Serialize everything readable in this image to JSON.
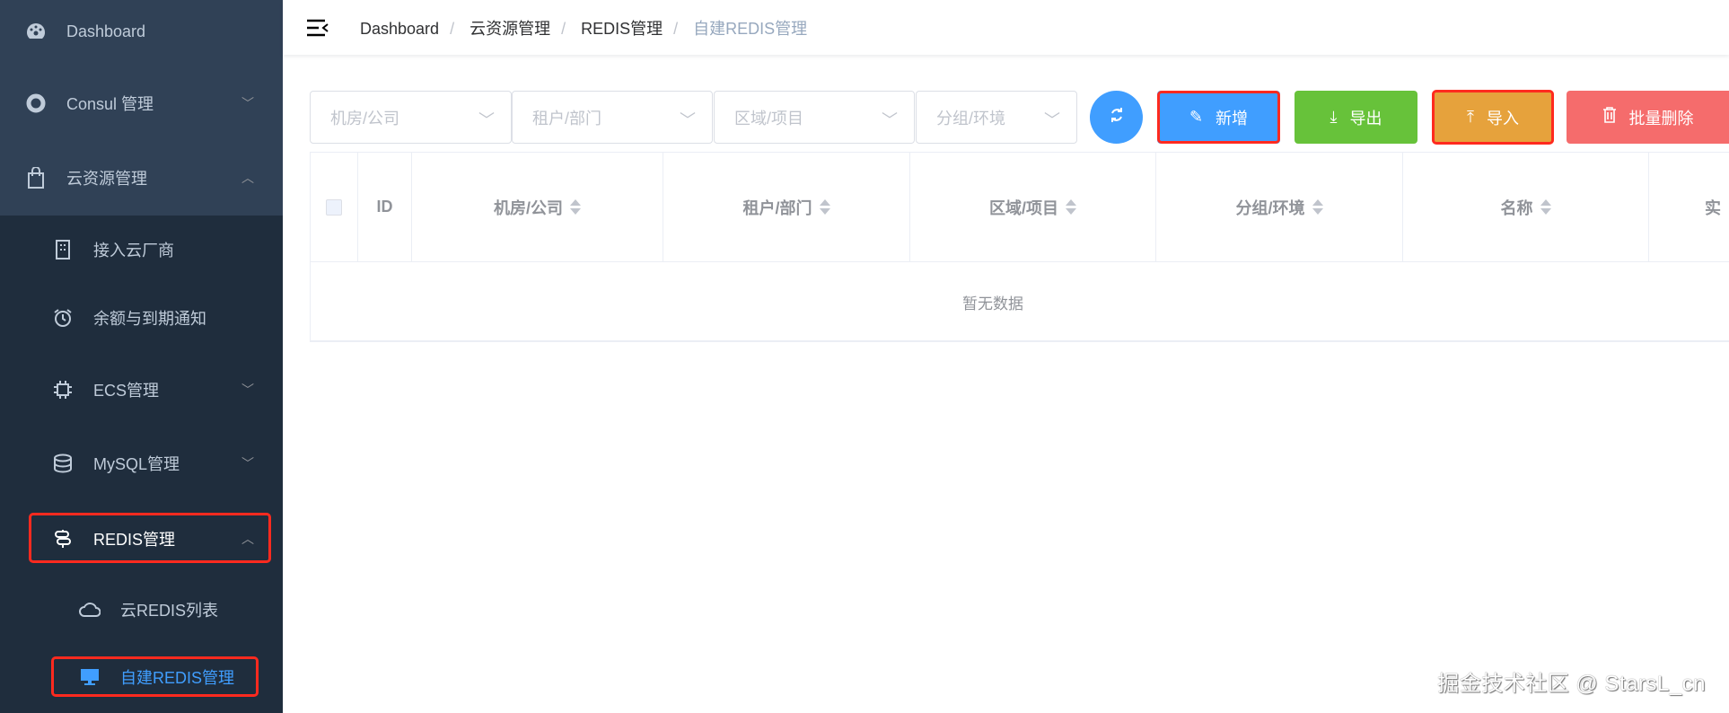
{
  "sidebar": {
    "items": [
      {
        "label": "Dashboard",
        "icon": "dashboard-icon"
      },
      {
        "label": "Consul 管理",
        "icon": "consul-icon"
      },
      {
        "label": "云资源管理",
        "icon": "shopping-bag-icon"
      },
      {
        "label": "接入云厂商",
        "icon": "building-icon"
      },
      {
        "label": "余额与到期通知",
        "icon": "alarm-clock-icon"
      },
      {
        "label": "ECS管理",
        "icon": "cpu-icon"
      },
      {
        "label": "MySQL管理",
        "icon": "database-icon"
      },
      {
        "label": "REDIS管理",
        "icon": "signpost-icon"
      },
      {
        "label": "云REDIS列表",
        "icon": "cloud-icon"
      },
      {
        "label": "自建REDIS管理",
        "icon": "monitor-icon",
        "active": true
      }
    ]
  },
  "breadcrumb": [
    "Dashboard",
    "云资源管理",
    "REDIS管理",
    "自建REDIS管理"
  ],
  "filters": [
    {
      "placeholder": "机房/公司"
    },
    {
      "placeholder": "租户/部门"
    },
    {
      "placeholder": "区域/项目"
    },
    {
      "placeholder": "分组/环境"
    }
  ],
  "toolbar": {
    "add": "新增",
    "export": "导出",
    "import": "导入",
    "batch_delete": "批量删除"
  },
  "colors": {
    "primary": "#409eff",
    "success": "#67c23a",
    "warning": "#e6a23c",
    "danger": "#f56c6c",
    "highlight": "#ff2a1f"
  },
  "table": {
    "columns": [
      "ID",
      "机房/公司",
      "租户/部门",
      "区域/项目",
      "分组/环境",
      "名称",
      "实"
    ],
    "empty_text": "暂无数据"
  },
  "watermark": "掘金技术社区 @ StarsL_cn"
}
